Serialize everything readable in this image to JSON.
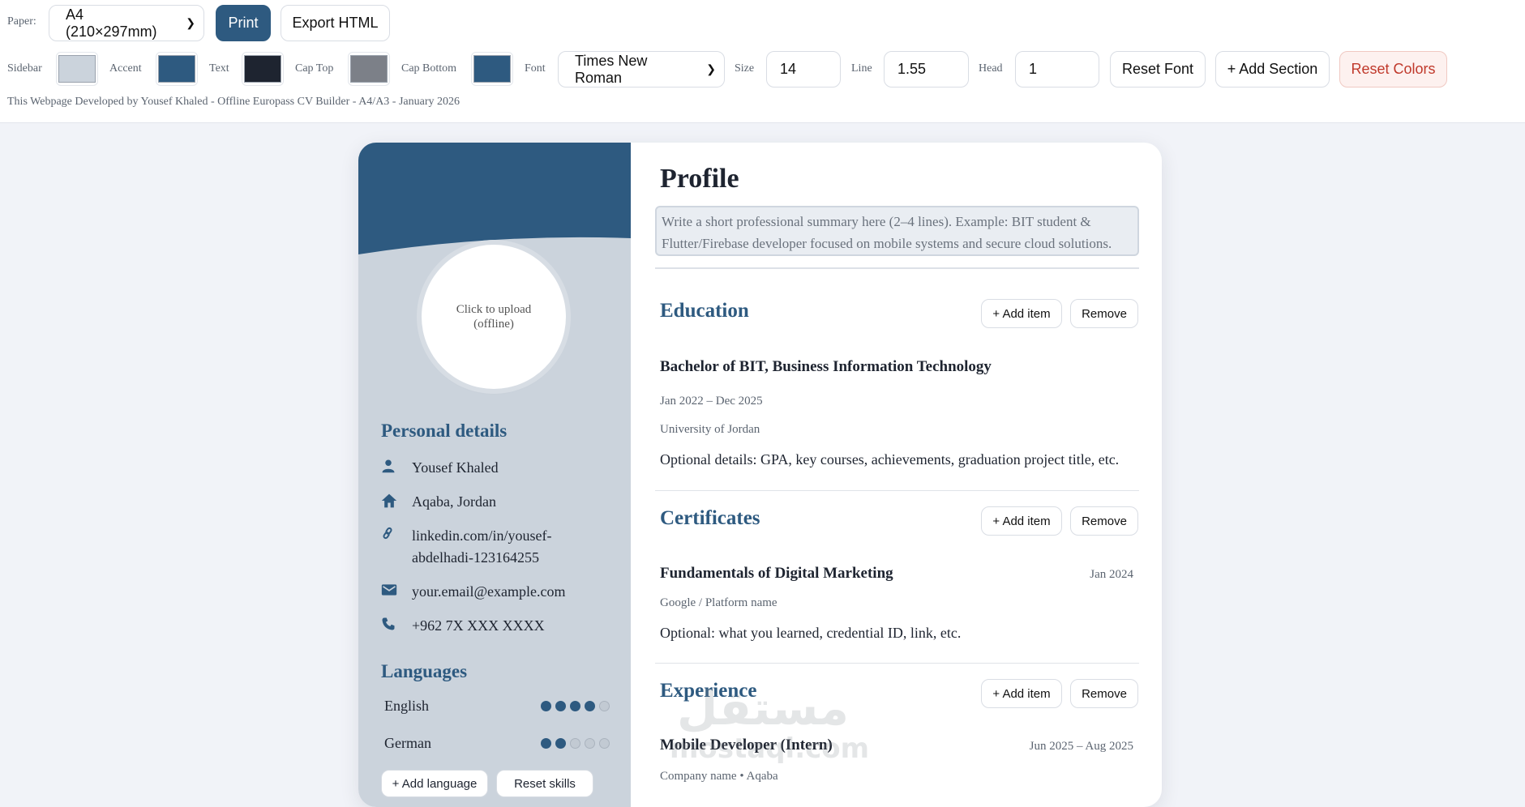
{
  "toolbar": {
    "paper_label": "Paper:",
    "paper_value": "A4 (210×297mm)",
    "print_label": "Print",
    "export_label": "Export HTML",
    "sidebar_label": "Sidebar",
    "accent_label": "Accent",
    "text_label": "Text",
    "cap_top_label": "Cap Top",
    "cap_bottom_label": "Cap Bottom",
    "font_label": "Font",
    "font_value": "Times New Roman",
    "size_label": "Size",
    "size_value": "14",
    "line_label": "Line",
    "line_value": "1.55",
    "head_label": "Head",
    "head_value": "1",
    "reset_font_label": "Reset Font",
    "add_section_label": "+ Add Section",
    "reset_colors_label": "Reset Colors",
    "credit": "This Webpage Developed by Yousef Khaled - Offline Europass CV Builder - A4/A3 - January 2026"
  },
  "colors": {
    "sidebar": "#cbd3dc",
    "accent": "#2e5a80",
    "text": "#1e2430",
    "cap_top": "#7c8088",
    "cap_bottom": "#2e5a80"
  },
  "sidebar": {
    "photo_text": "Click to upload (offline)",
    "personal_heading": "Personal details",
    "personal": [
      {
        "icon": "person-icon",
        "text": "Yousef Khaled"
      },
      {
        "icon": "home-icon",
        "text": "Aqaba, Jordan"
      },
      {
        "icon": "link-icon",
        "text": "linkedin.com/in/yousef-abdelhadi-123164255"
      },
      {
        "icon": "mail-icon",
        "text": "your.email@example.com"
      },
      {
        "icon": "phone-icon",
        "text": "+962 7X XXX XXXX"
      }
    ],
    "languages_heading": "Languages",
    "languages": [
      {
        "name": "English",
        "level": 4,
        "max": 5
      },
      {
        "name": "German",
        "level": 2,
        "max": 5
      }
    ],
    "add_language_label": "+ Add language",
    "reset_label": "Reset skills"
  },
  "main": {
    "profile_heading": "Profile",
    "profile_summary": "Write a short professional summary here (2–4 lines). Example: BIT student & Flutter/Firebase developer focused on mobile systems and secure cloud solutions.",
    "add_item_label": "+ Add item",
    "remove_label": "Remove",
    "education": {
      "heading": "Education",
      "title": "Bachelor of BIT, Business Information Technology",
      "dates": "Jan 2022 – Dec 2025",
      "org": "University of Jordan",
      "desc": "Optional details: GPA, key courses, achievements, graduation project title, etc."
    },
    "certificates": {
      "heading": "Certificates",
      "title": "Fundamentals of Digital Marketing",
      "date": "Jan 2024",
      "org": "Google / Platform name",
      "desc": "Optional: what you learned, credential ID, link, etc."
    },
    "experience": {
      "heading": "Experience",
      "title": "Mobile Developer (Intern)",
      "dates": "Jun 2025 – Aug 2025",
      "org": "Company name • Aqaba"
    }
  },
  "watermark": {
    "arabic": "مستقل",
    "latin": "mostaql.com"
  }
}
